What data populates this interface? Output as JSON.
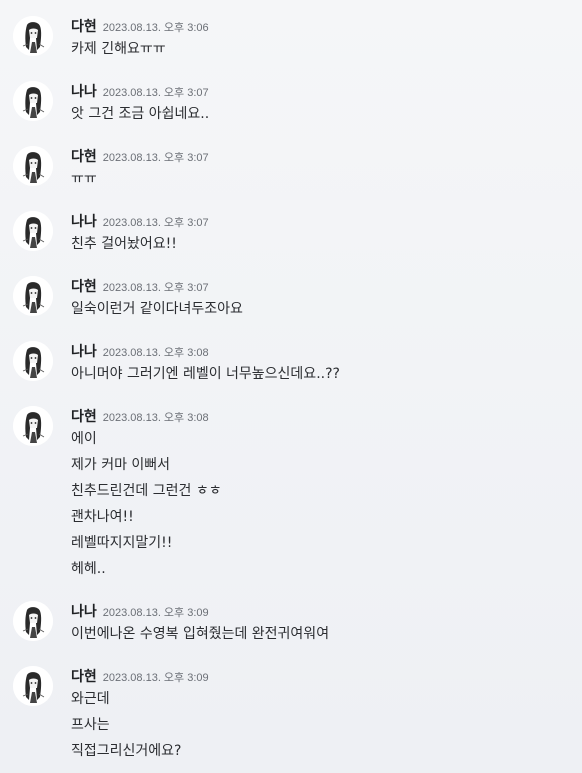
{
  "messages": [
    {
      "author": "다현",
      "timestamp": "2023.08.13. 오후 3:06",
      "lines": [
        "카제 긴해요ㅠㅠ"
      ]
    },
    {
      "author": "나나",
      "timestamp": "2023.08.13. 오후 3:07",
      "lines": [
        "앗 그건 조금 아쉽네요.."
      ]
    },
    {
      "author": "다현",
      "timestamp": "2023.08.13. 오후 3:07",
      "lines": [
        "ㅠㅠ"
      ]
    },
    {
      "author": "나나",
      "timestamp": "2023.08.13. 오후 3:07",
      "lines": [
        "친추 걸어놨어요!!"
      ]
    },
    {
      "author": "다현",
      "timestamp": "2023.08.13. 오후 3:07",
      "lines": [
        "일숙이런거 같이다녀두조아요"
      ]
    },
    {
      "author": "나나",
      "timestamp": "2023.08.13. 오후 3:08",
      "lines": [
        "아니머야 그러기엔 레벨이 너무높으신데요..??"
      ]
    },
    {
      "author": "다현",
      "timestamp": "2023.08.13. 오후 3:08",
      "lines": [
        "에이",
        "제가 커마 이뻐서",
        "친추드린건데 그런건 ㅎㅎ",
        "괜차나여!!",
        "레벨따지지말기!!",
        "헤헤.."
      ]
    },
    {
      "author": "나나",
      "timestamp": "2023.08.13. 오후 3:09",
      "lines": [
        "이번에나온 수영복 입혀줬는데 완전귀여워여"
      ]
    },
    {
      "author": "다현",
      "timestamp": "2023.08.13. 오후 3:09",
      "lines": [
        "와근데",
        "프사는",
        "직접그리신거에요?"
      ]
    }
  ]
}
